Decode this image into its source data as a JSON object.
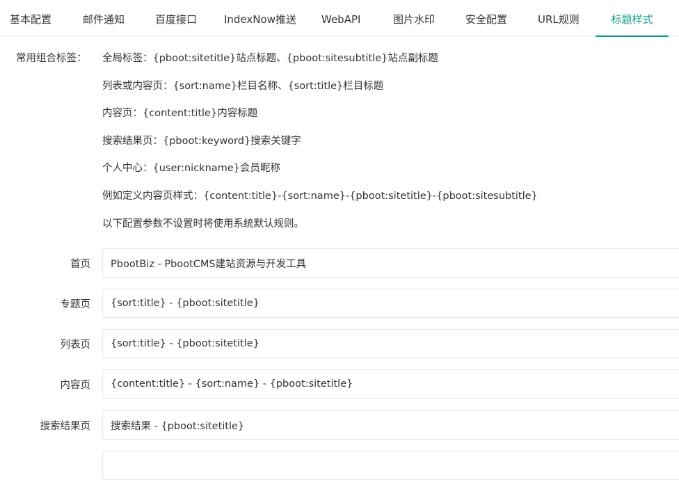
{
  "tabs": [
    {
      "label": "基本配置"
    },
    {
      "label": "邮件通知"
    },
    {
      "label": "百度接口"
    },
    {
      "label": "IndexNow推送"
    },
    {
      "label": "WebAPI"
    },
    {
      "label": "图片水印"
    },
    {
      "label": "安全配置"
    },
    {
      "label": "URL规则"
    },
    {
      "label": "标题样式",
      "active": true
    }
  ],
  "hints": {
    "label": "常用组合标签：",
    "lines": [
      "全局标签：{pboot:sitetitle}站点标题、{pboot:sitesubtitle}站点副标题",
      "列表或内容页：{sort:name}栏目名称、{sort:title}栏目标题",
      "内容页：{content:title}内容标题",
      "搜索结果页：{pboot:keyword}搜索关键字",
      "个人中心：{user:nickname}会员昵称",
      "例如定义内容页样式：{content:title}-{sort:name}-{pboot:sitetitle}-{pboot:sitesubtitle}",
      "以下配置参数不设置时将使用系统默认规则。"
    ]
  },
  "fields": [
    {
      "label": "首页",
      "value": "PbootBiz - PbootCMS建站资源与开发工具"
    },
    {
      "label": "专题页",
      "value": "{sort:title} - {pboot:sitetitle}"
    },
    {
      "label": "列表页",
      "value": "{sort:title} - {pboot:sitetitle}"
    },
    {
      "label": "内容页",
      "value": "{content:title} - {sort:name} - {pboot:sitetitle}"
    },
    {
      "label": "搜索结果页",
      "value": "搜索结果 - {pboot:sitetitle}"
    },
    {
      "label": "",
      "value": ""
    }
  ]
}
